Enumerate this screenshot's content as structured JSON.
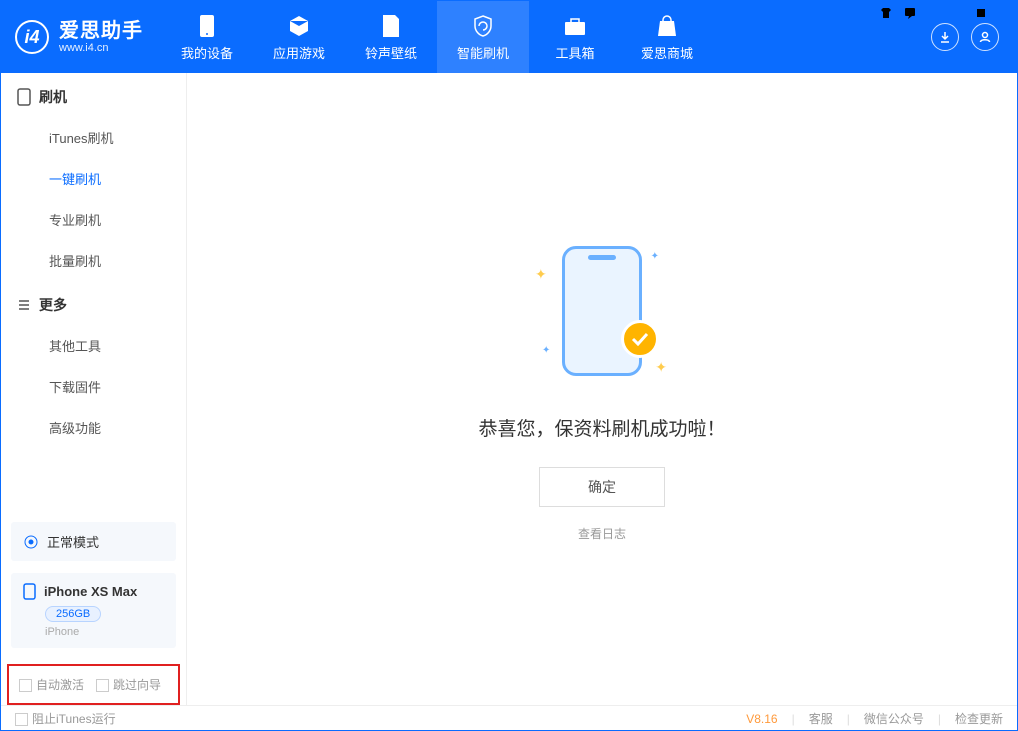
{
  "app": {
    "name": "爱思助手",
    "url": "www.i4.cn"
  },
  "nav": {
    "tabs": [
      {
        "label": "我的设备"
      },
      {
        "label": "应用游戏"
      },
      {
        "label": "铃声壁纸"
      },
      {
        "label": "智能刷机"
      },
      {
        "label": "工具箱"
      },
      {
        "label": "爱思商城"
      }
    ]
  },
  "sidebar": {
    "group1": {
      "title": "刷机",
      "items": [
        "iTunes刷机",
        "一键刷机",
        "专业刷机",
        "批量刷机"
      ]
    },
    "group2": {
      "title": "更多",
      "items": [
        "其他工具",
        "下载固件",
        "高级功能"
      ]
    },
    "mode": "正常模式",
    "device": {
      "name": "iPhone XS Max",
      "capacity": "256GB",
      "type": "iPhone"
    },
    "checkbox1": "自动激活",
    "checkbox2": "跳过向导"
  },
  "main": {
    "success_msg": "恭喜您，保资料刷机成功啦！",
    "ok_btn": "确定",
    "view_log": "查看日志"
  },
  "footer": {
    "block_itunes": "阻止iTunes运行",
    "version": "V8.16",
    "link1": "客服",
    "link2": "微信公众号",
    "link3": "检查更新"
  }
}
